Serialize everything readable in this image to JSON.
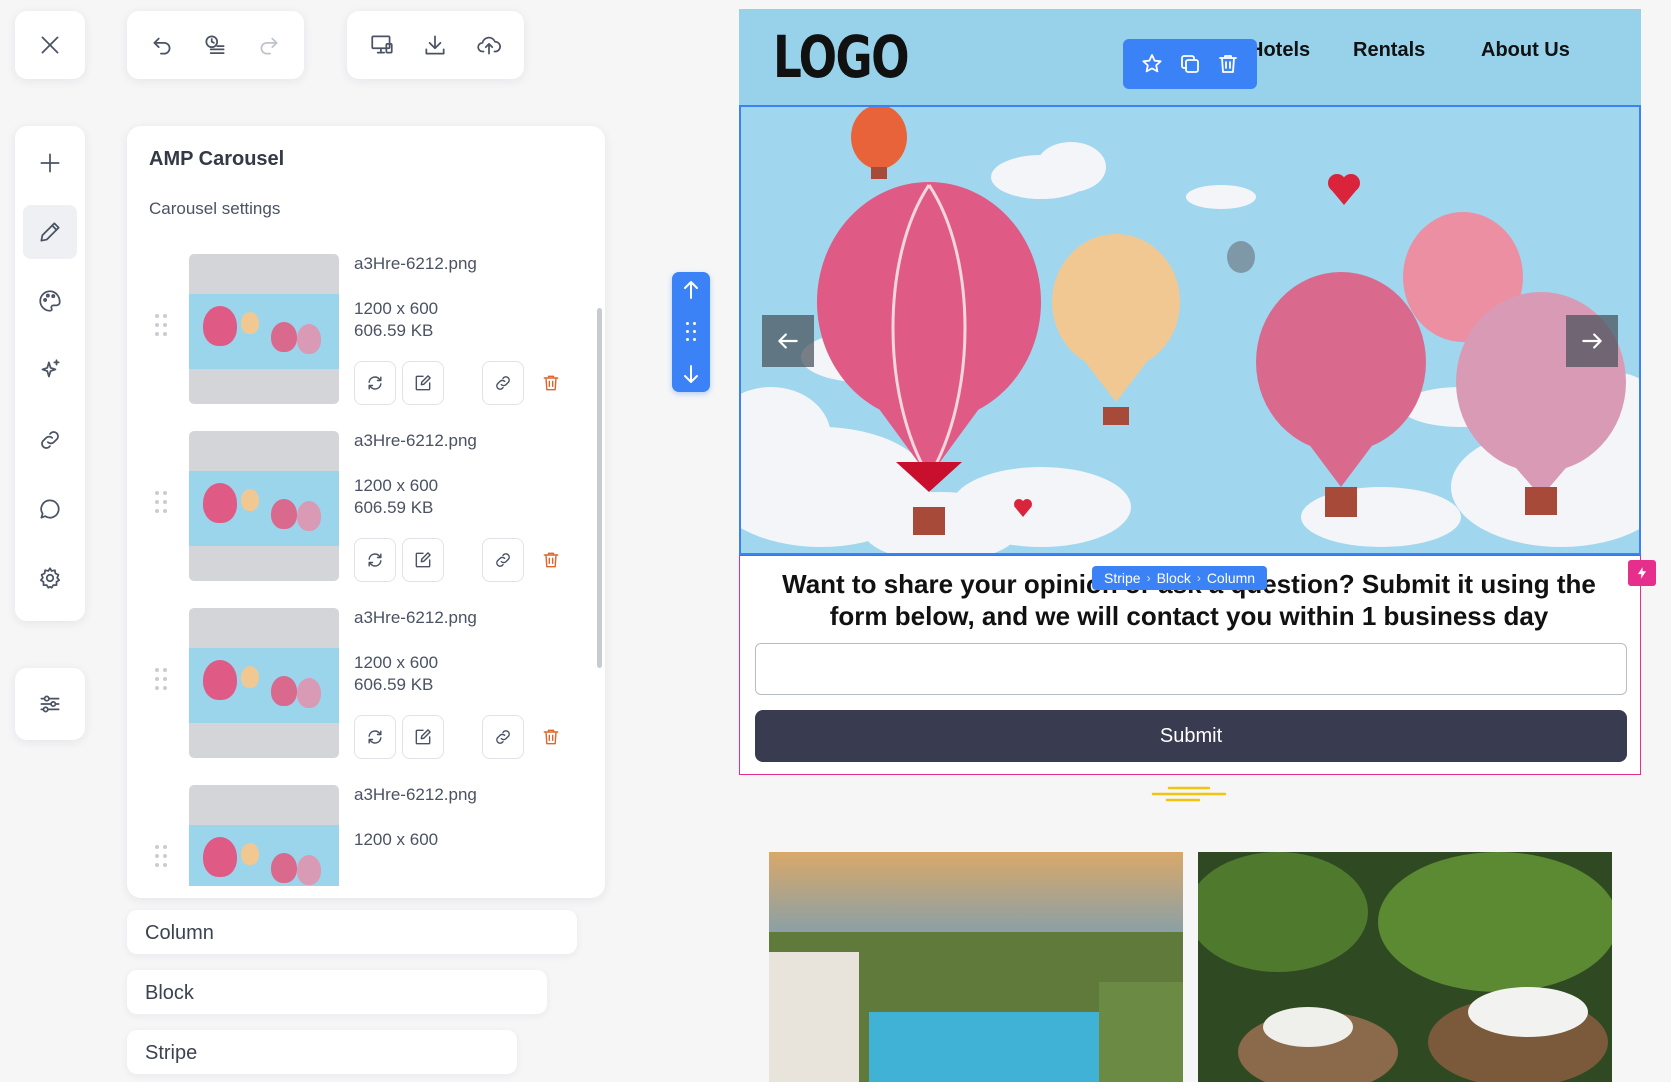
{
  "panel": {
    "title": "AMP Carousel",
    "subtitle": "Carousel settings",
    "items": [
      {
        "filename": "a3Hre-6212.png",
        "dimensions": "1200 x 600",
        "size": "606.59 KB"
      },
      {
        "filename": "a3Hre-6212.png",
        "dimensions": "1200 x 600",
        "size": "606.59 KB"
      },
      {
        "filename": "a3Hre-6212.png",
        "dimensions": "1200 x 600",
        "size": "606.59 KB"
      },
      {
        "filename": "a3Hre-6212.png",
        "dimensions": "1200 x 600",
        "size": ""
      }
    ]
  },
  "breadcrumbs_panel": [
    "Column",
    "Block",
    "Stripe"
  ],
  "email": {
    "logo": "LOGO",
    "nav": [
      "Hotels",
      "Rentals",
      "About Us"
    ],
    "form": {
      "heading": "Want to share your opinion or ask a question? Submit it using the form below, and we will contact you within 1 business day",
      "input_value": "",
      "submit_label": "Submit"
    },
    "selection_path": [
      "Stripe",
      "Block",
      "Column"
    ]
  },
  "colors": {
    "accent": "#3b82f6",
    "selection_pink": "#e62f8d",
    "header_bg": "#97d2ea",
    "submit_bg": "#393c51",
    "delete": "#e0642b"
  },
  "icons": {
    "toolbar": [
      "close-icon",
      "undo-icon",
      "version-history-icon",
      "redo-icon",
      "preview-icon",
      "download-icon",
      "upload-icon"
    ],
    "sidebar": [
      "plus-icon",
      "pencil-icon",
      "palette-icon",
      "sparkles-icon",
      "link-icon",
      "comment-icon",
      "gear-icon",
      "sliders-icon"
    ],
    "item_actions": [
      "replace-icon",
      "edit-icon",
      "link-icon",
      "trash-icon"
    ]
  }
}
